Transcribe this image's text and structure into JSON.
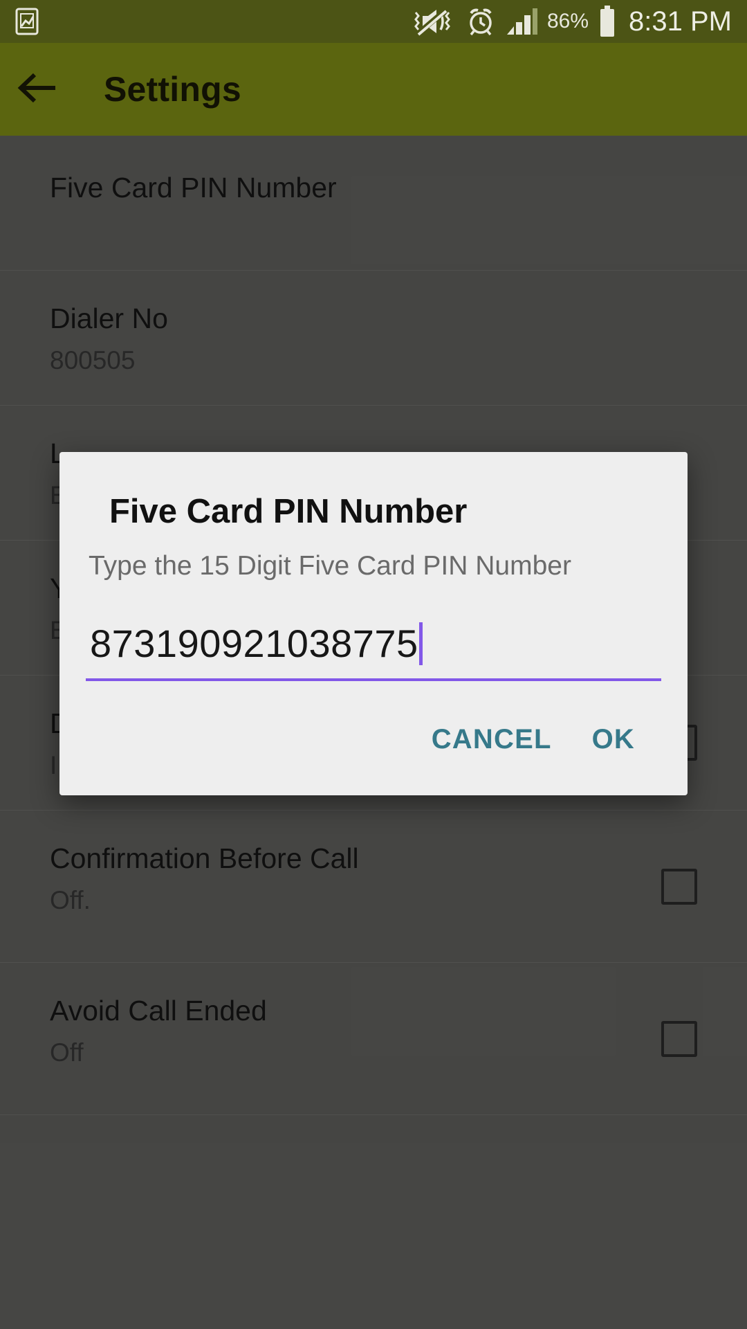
{
  "statusbar": {
    "time": "8:31 PM",
    "battery_percent": "86%",
    "icons": [
      "screenshot-icon",
      "vibrate-mute-icon",
      "alarm-icon",
      "signal-icon",
      "battery-icon"
    ]
  },
  "appbar": {
    "title": "Settings",
    "back_icon": "back-arrow-icon"
  },
  "settings_rows": [
    {
      "title": "Five Card PIN Number",
      "sub": "",
      "checkbox": false
    },
    {
      "title": "Dialer No",
      "sub": "800505",
      "checkbox": false
    },
    {
      "title": "L",
      "sub": "E",
      "checkbox": false
    },
    {
      "title": "Y",
      "sub": "E",
      "checkbox": false
    },
    {
      "title": "D",
      "sub": "I",
      "checkbox": true
    },
    {
      "title": "Confirmation Before Call",
      "sub": "Off.",
      "checkbox": true
    },
    {
      "title": "Avoid Call Ended",
      "sub": "Off",
      "checkbox": true
    }
  ],
  "dialog": {
    "title": "Five Card PIN Number",
    "message": "Type the 15 Digit Five Card PIN Number",
    "input_value": "873190921038775",
    "cancel_label": "CANCEL",
    "ok_label": "OK"
  },
  "colors": {
    "statusbar_bg": "#4c5415",
    "appbar_bg": "#5b650f",
    "accent_underline": "#8258e8",
    "button_text": "#36798a",
    "dialog_bg": "#eeeeee"
  }
}
